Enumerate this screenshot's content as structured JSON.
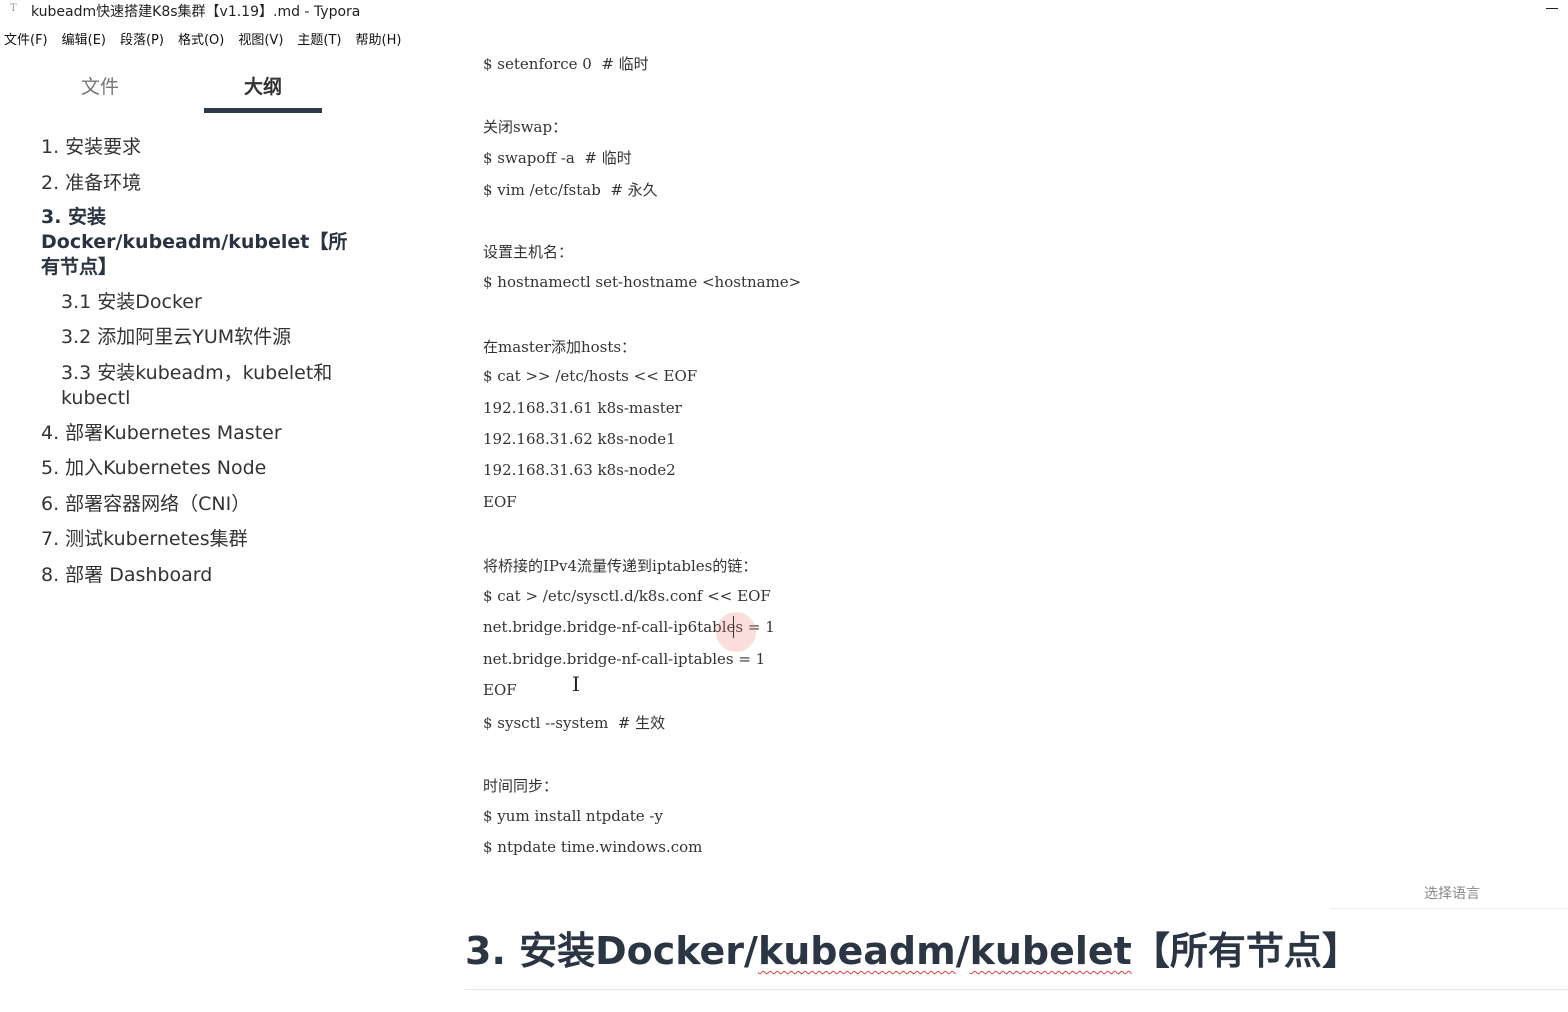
{
  "window": {
    "title": "kubeadm快速搭建K8s集群【v1.19】.md - Typora",
    "app_icon": "T"
  },
  "menu": [
    "文件(F)",
    "编辑(E)",
    "段落(P)",
    "格式(O)",
    "视图(V)",
    "主题(T)",
    "帮助(H)"
  ],
  "sidebar": {
    "tabs": [
      "文件",
      "大纲"
    ],
    "outline": [
      "1. 安装要求",
      "2. 准备环境",
      "3. 安装Docker/kubeadm/kubelet【所有节点】",
      "3.1 安装Docker",
      "3.2 添加阿里云YUM软件源",
      "3.3 安装kubeadm，kubelet和kubectl",
      "4. 部署Kubernetes Master",
      "5. 加入Kubernetes Node",
      "6. 部署容器网络（CNI）",
      "7. 测试kubernetes集群",
      "8. 部署 Dashboard"
    ]
  },
  "editor": {
    "lines": [
      "$ setenforce 0  # 临时",
      "关闭swap：",
      "$ swapoff -a  # 临时",
      "$ vim /etc/fstab  # 永久",
      "设置主机名：",
      "$ hostnamectl set-hostname <hostname>",
      "在master添加hosts：",
      "$ cat >> /etc/hosts << EOF",
      "192.168.31.61 k8s-master",
      "192.168.31.62 k8s-node1",
      "192.168.31.63 k8s-node2",
      "EOF",
      "将桥接的IPv4流量传递到iptables的链：",
      "$ cat > /etc/sysctl.d/k8s.conf << EOF",
      "net.bridge.bridge-nf-call-ip6tables = 1",
      "net.bridge.bridge-nf-call-iptables = 1",
      "EOF",
      "$ sysctl --system  # 生效",
      "时间同步：",
      "$ yum install ntpdate -y",
      "$ ntpdate time.windows.com"
    ],
    "select_language": "选择语言",
    "heading": {
      "prefix": "3. 安装Docker/",
      "word1": "kubeadm",
      "sep": "/",
      "word2": "kubelet",
      "suffix": "【所有节点】"
    }
  }
}
